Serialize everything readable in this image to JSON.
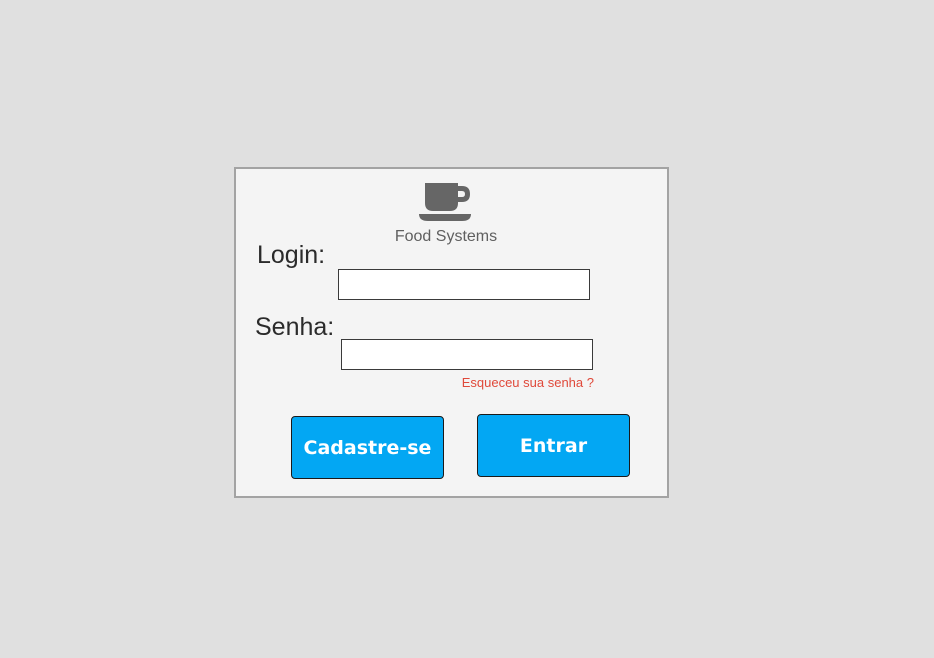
{
  "app": {
    "brand_name": "Food Systems",
    "logo_icon": "coffee-cup-icon",
    "accent_color": "#03a7f3",
    "link_color": "#e0493a"
  },
  "form": {
    "login_label": "Login:",
    "login_value": "",
    "login_placeholder": "",
    "senha_label": "Senha:",
    "senha_value": "",
    "senha_placeholder": "",
    "forgot_link": "Esqueceu sua senha ?"
  },
  "buttons": {
    "signup_label": "Cadastre-se",
    "enter_label": "Entrar"
  }
}
